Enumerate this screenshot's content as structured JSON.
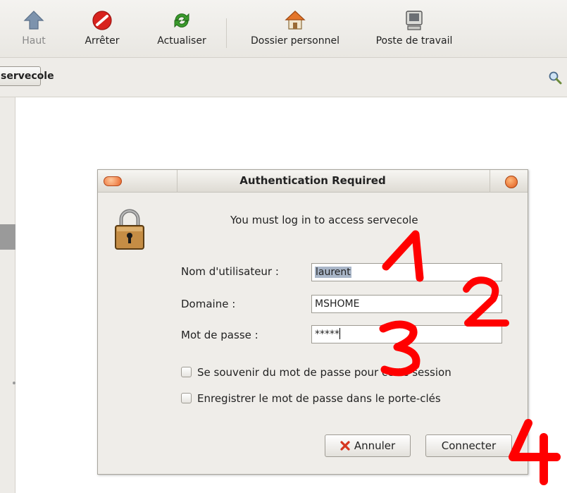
{
  "toolbar": {
    "up": {
      "label": "Haut",
      "icon": "arrow-up-icon"
    },
    "stop": {
      "label": "Arrêter",
      "icon": "stop-icon"
    },
    "refresh": {
      "label": "Actualiser",
      "icon": "refresh-icon"
    },
    "home": {
      "label": "Dossier personnel",
      "icon": "home-icon"
    },
    "computer": {
      "label": "Poste de travail",
      "icon": "computer-icon"
    }
  },
  "location": {
    "path_button": "servecole"
  },
  "dialog": {
    "title": "Authentication Required",
    "message": "You must log in to access servecole",
    "username": {
      "label": "Nom d'utilisateur :",
      "value": "laurent"
    },
    "domain": {
      "label": "Domaine :",
      "value": "MSHOME"
    },
    "password": {
      "label": "Mot de passe :",
      "value": "*****"
    },
    "remember_session": {
      "label": "Se souvenir du mot de passe pour cette session",
      "checked": false
    },
    "save_keyring": {
      "label": "Enregistrer le mot de passe dans le porte-clés",
      "checked": false
    },
    "cancel_label": "Annuler",
    "connect_label": "Connecter"
  },
  "annotations": {
    "n1": "1",
    "n2": "2",
    "n3": "3",
    "n4": "4",
    "color": "#ff0000"
  },
  "colors": {
    "selection": "#a9b6c8",
    "accent_orange": "#e8672c"
  }
}
